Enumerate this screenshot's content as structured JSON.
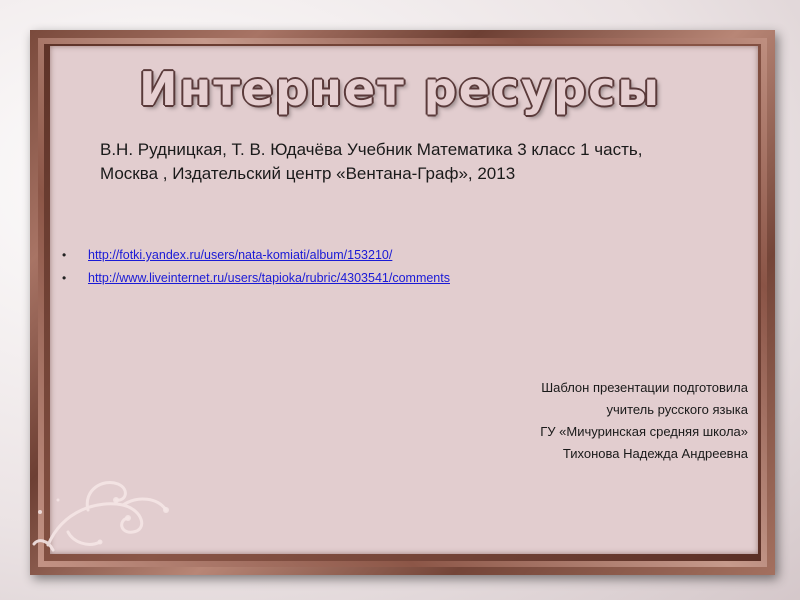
{
  "slide": {
    "title": "Интернет ресурсы",
    "source": {
      "line1": "В.Н. Рудницкая, Т. В. Юдачёва Учебник Математика 3 класс 1 часть,",
      "line2": "Москва , Издательский центр «Вентана-Граф», 2013"
    },
    "links": [
      {
        "text": "http://fotki.yandex.ru/users/nata-komiati/album/153210/"
      },
      {
        "text": "http://www.liveinternet.ru/users/tapioka/rubric/4303541/comments"
      }
    ],
    "credits": [
      "Шаблон презентации подготовила",
      "учитель русского языка",
      "ГУ «Мичуринская средняя школа»",
      "Тихонова Надежда Андреевна"
    ],
    "bullet_glyph": "•",
    "colors": {
      "panel": "#e2cdcf",
      "link": "#1a1ad6",
      "frame": "#8a5446"
    },
    "icons": {
      "ornament": "floral-swirl-icon"
    }
  }
}
